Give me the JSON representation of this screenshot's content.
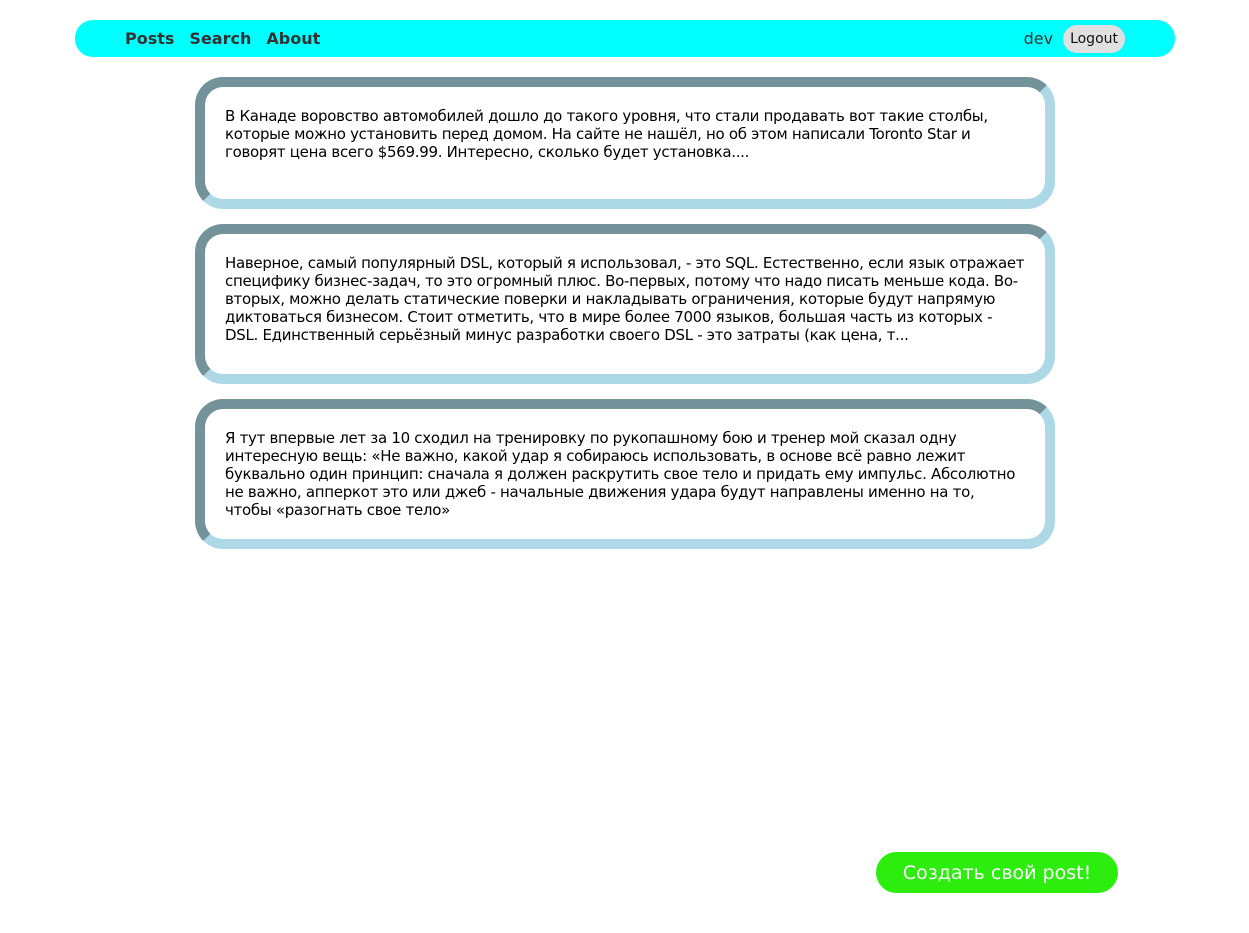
{
  "nav": {
    "items": [
      "Posts",
      "Search",
      "About"
    ],
    "user": "dev",
    "logout": "Logout"
  },
  "posts": [
    "В Канаде воровство автомобилей дошло до такого уровня, что стали продавать вот такие столбы, которые можно установить перед домом. На сайте не нашёл, но об этом написали Toronto Star и говорят цена всего $569.99. Интересно, сколько будет установка....",
    "Наверное, самый популярный DSL, который я использовал, - это SQL. Естественно, если язык отражает специфику бизнес-задач, то это огромный плюс. Во-первых, потому что надо писать меньше кода. Во-вторых, можно делать статические поверки и накладывать ограничения, которые будут напрямую диктоваться бизнесом. Стоит отметить, что в мире более 7000 языков, большая часть из которых - DSL. Единственный серьёзный минус разработки своего DSL - это затраты (как цена, т...",
    "Я тут впервые лет за 10 сходил на тренировку по рукопашному бою и тренер мой сказал одну интересную вещь: «Не важно, какой удар я собираюсь использовать, в основе всё равно лежит буквально один принцип: сначала я должен раскрутить свое тело и придать ему импульс. Абсолютно не важно, апперкот это или джеб - начальные движения удара будут направлены именно на то, чтобы «разогнать свое тело»"
  ],
  "create_button": "Создать свой post!",
  "colors": {
    "nav": "#00ffff",
    "border_dark": "#749299",
    "border_light": "#add8e6",
    "create": "#2ded0f"
  }
}
